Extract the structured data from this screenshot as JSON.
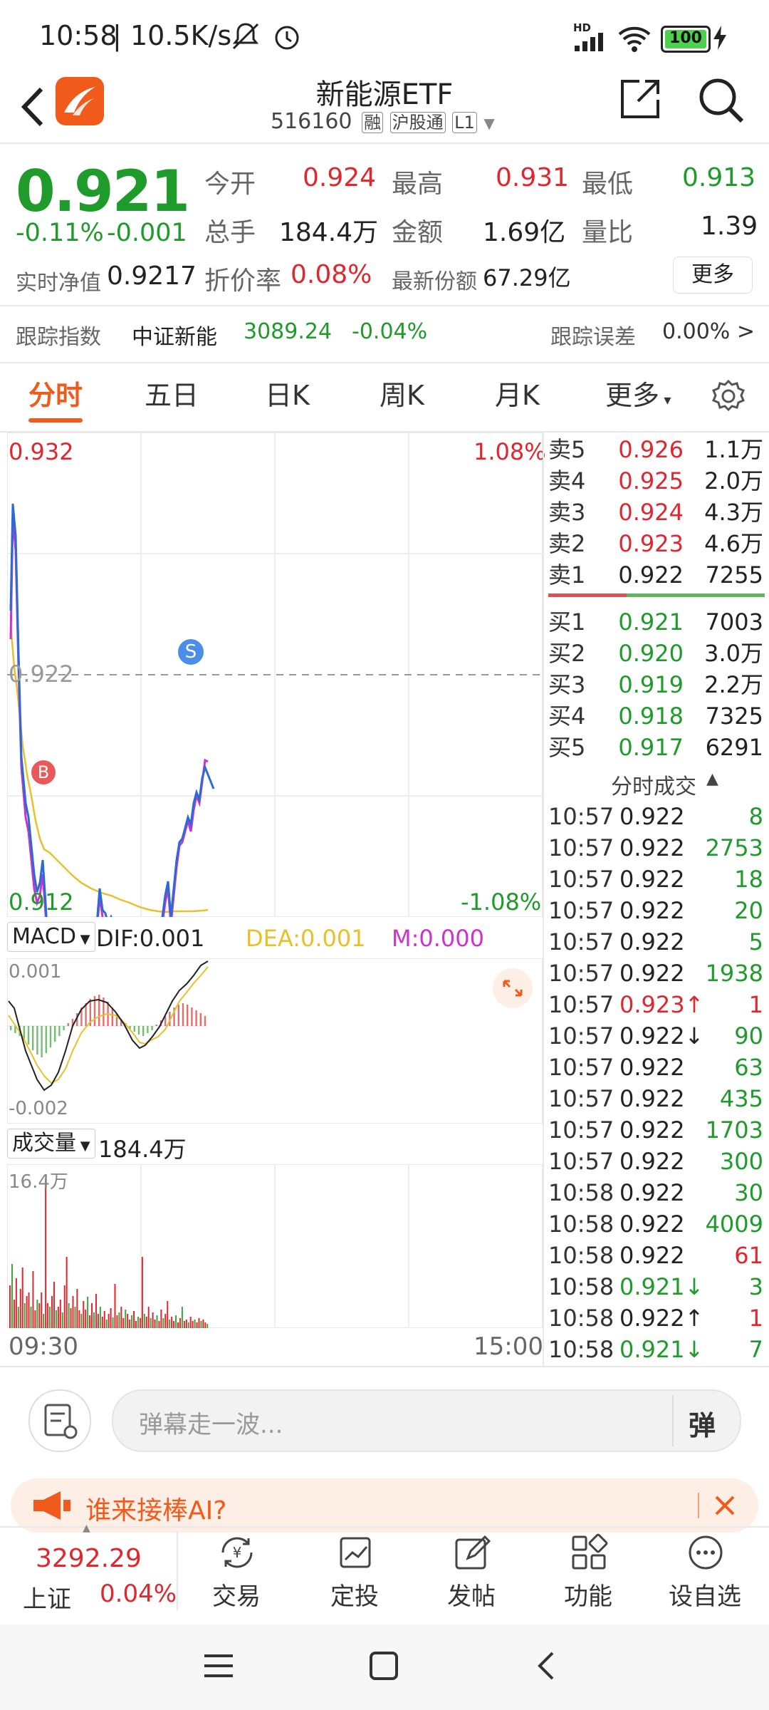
{
  "status": {
    "time": "10:58",
    "speed": "10.5K/s",
    "battery": "100",
    "hd": "HD"
  },
  "nav": {
    "title": "新能源ETF",
    "code": "516160",
    "badge1": "融",
    "badge2": "沪股通",
    "badge3": "L1"
  },
  "quote": {
    "price": "0.921",
    "change_pct": "-0.11%",
    "change": "-0.001",
    "open_label": "今开",
    "open": "0.924",
    "high_label": "最高",
    "high": "0.931",
    "low_label": "最低",
    "low": "0.913",
    "vol_label": "总手",
    "vol": "184.4万",
    "amt_label": "金额",
    "amt": "1.69亿",
    "ratio_label": "量比",
    "ratio": "1.39",
    "nav_label": "实时净值",
    "nav": "0.9217",
    "disc_label": "折价率",
    "disc": "0.08%",
    "share_label": "最新份额",
    "share": "67.29亿",
    "more": "更多"
  },
  "tracking": {
    "label": "跟踪指数",
    "index": "中证新能",
    "value": "3089.24",
    "pct": "-0.04%",
    "err_label": "跟踪误差",
    "err": "0.00% >"
  },
  "tabs": [
    "分时",
    "五日",
    "日K",
    "周K",
    "月K",
    "更多"
  ],
  "chart": {
    "price_high": "0.932",
    "price_low": "0.912",
    "pct_high": "1.08%",
    "pct_low": "-1.08%",
    "last_price_label": "0.922",
    "marker_buy": "B",
    "marker_sell": "S",
    "time_start": "09:30",
    "time_end": "15:00"
  },
  "macd": {
    "label": "MACD",
    "dif": "DIF:0.001",
    "dea": "DEA:0.001",
    "m": "M:0.000",
    "top": "0.001",
    "bottom": "-0.002"
  },
  "volume": {
    "label": "成交量",
    "value": "184.4万",
    "top": "16.4万"
  },
  "orderbook": {
    "asks": [
      {
        "label": "卖5",
        "price": "0.926",
        "vol": "1.1万"
      },
      {
        "label": "卖4",
        "price": "0.925",
        "vol": "2.0万"
      },
      {
        "label": "卖3",
        "price": "0.924",
        "vol": "4.3万"
      },
      {
        "label": "卖2",
        "price": "0.923",
        "vol": "4.6万"
      },
      {
        "label": "卖1",
        "price": "0.922",
        "vol": "7255"
      }
    ],
    "bids": [
      {
        "label": "买1",
        "price": "0.921",
        "vol": "7003"
      },
      {
        "label": "买2",
        "price": "0.920",
        "vol": "3.0万"
      },
      {
        "label": "买3",
        "price": "0.919",
        "vol": "2.2万"
      },
      {
        "label": "买4",
        "price": "0.918",
        "vol": "7325"
      },
      {
        "label": "买5",
        "price": "0.917",
        "vol": "6291"
      }
    ]
  },
  "ticks_title": "分时成交",
  "ticks": [
    {
      "time": "10:57",
      "price": "0.922",
      "vol": "8",
      "pc": "black",
      "vc": "green"
    },
    {
      "time": "10:57",
      "price": "0.922",
      "vol": "2753",
      "pc": "black",
      "vc": "green"
    },
    {
      "time": "10:57",
      "price": "0.922",
      "vol": "18",
      "pc": "black",
      "vc": "green"
    },
    {
      "time": "10:57",
      "price": "0.922",
      "vol": "20",
      "pc": "black",
      "vc": "green"
    },
    {
      "time": "10:57",
      "price": "0.922",
      "vol": "5",
      "pc": "black",
      "vc": "green"
    },
    {
      "time": "10:57",
      "price": "0.922",
      "vol": "1938",
      "pc": "black",
      "vc": "green"
    },
    {
      "time": "10:57",
      "price": "0.923↑",
      "vol": "1",
      "pc": "red",
      "vc": "red"
    },
    {
      "time": "10:57",
      "price": "0.922↓",
      "vol": "90",
      "pc": "black",
      "vc": "green"
    },
    {
      "time": "10:57",
      "price": "0.922",
      "vol": "63",
      "pc": "black",
      "vc": "green"
    },
    {
      "time": "10:57",
      "price": "0.922",
      "vol": "435",
      "pc": "black",
      "vc": "green"
    },
    {
      "time": "10:57",
      "price": "0.922",
      "vol": "1703",
      "pc": "black",
      "vc": "green"
    },
    {
      "time": "10:57",
      "price": "0.922",
      "vol": "300",
      "pc": "black",
      "vc": "green"
    },
    {
      "time": "10:58",
      "price": "0.922",
      "vol": "30",
      "pc": "black",
      "vc": "green"
    },
    {
      "time": "10:58",
      "price": "0.922",
      "vol": "4009",
      "pc": "black",
      "vc": "green"
    },
    {
      "time": "10:58",
      "price": "0.922",
      "vol": "61",
      "pc": "black",
      "vc": "red"
    },
    {
      "time": "10:58",
      "price": "0.921↓",
      "vol": "3",
      "pc": "green",
      "vc": "green"
    },
    {
      "time": "10:58",
      "price": "0.922↑",
      "vol": "1",
      "pc": "black",
      "vc": "red"
    },
    {
      "time": "10:58",
      "price": "0.921↓",
      "vol": "7",
      "pc": "green",
      "vc": "green"
    }
  ],
  "comment": {
    "placeholder": "弹幕走一波...",
    "danmu": "弹"
  },
  "ai_banner": {
    "text": "谁来接棒AI?"
  },
  "bottom": {
    "index_value": "3292.29",
    "index_name": "上证",
    "index_pct": "0.04%",
    "buttons": [
      "交易",
      "定投",
      "发帖",
      "功能",
      "设自选"
    ]
  },
  "colors": {
    "up": "#e0262f",
    "down": "#1f9b2c",
    "accent": "#f05a1a"
  }
}
